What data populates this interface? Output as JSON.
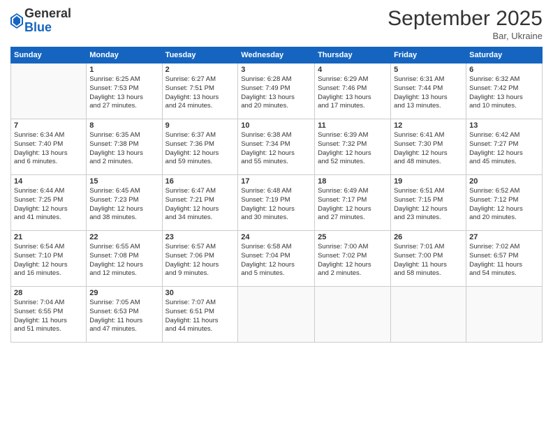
{
  "logo": {
    "general": "General",
    "blue": "Blue"
  },
  "title": "September 2025",
  "location": "Bar, Ukraine",
  "weekdays": [
    "Sunday",
    "Monday",
    "Tuesday",
    "Wednesday",
    "Thursday",
    "Friday",
    "Saturday"
  ],
  "weeks": [
    [
      {
        "day": "",
        "info": ""
      },
      {
        "day": "1",
        "info": "Sunrise: 6:25 AM\nSunset: 7:53 PM\nDaylight: 13 hours\nand 27 minutes."
      },
      {
        "day": "2",
        "info": "Sunrise: 6:27 AM\nSunset: 7:51 PM\nDaylight: 13 hours\nand 24 minutes."
      },
      {
        "day": "3",
        "info": "Sunrise: 6:28 AM\nSunset: 7:49 PM\nDaylight: 13 hours\nand 20 minutes."
      },
      {
        "day": "4",
        "info": "Sunrise: 6:29 AM\nSunset: 7:46 PM\nDaylight: 13 hours\nand 17 minutes."
      },
      {
        "day": "5",
        "info": "Sunrise: 6:31 AM\nSunset: 7:44 PM\nDaylight: 13 hours\nand 13 minutes."
      },
      {
        "day": "6",
        "info": "Sunrise: 6:32 AM\nSunset: 7:42 PM\nDaylight: 13 hours\nand 10 minutes."
      }
    ],
    [
      {
        "day": "7",
        "info": "Sunrise: 6:34 AM\nSunset: 7:40 PM\nDaylight: 13 hours\nand 6 minutes."
      },
      {
        "day": "8",
        "info": "Sunrise: 6:35 AM\nSunset: 7:38 PM\nDaylight: 13 hours\nand 2 minutes."
      },
      {
        "day": "9",
        "info": "Sunrise: 6:37 AM\nSunset: 7:36 PM\nDaylight: 12 hours\nand 59 minutes."
      },
      {
        "day": "10",
        "info": "Sunrise: 6:38 AM\nSunset: 7:34 PM\nDaylight: 12 hours\nand 55 minutes."
      },
      {
        "day": "11",
        "info": "Sunrise: 6:39 AM\nSunset: 7:32 PM\nDaylight: 12 hours\nand 52 minutes."
      },
      {
        "day": "12",
        "info": "Sunrise: 6:41 AM\nSunset: 7:30 PM\nDaylight: 12 hours\nand 48 minutes."
      },
      {
        "day": "13",
        "info": "Sunrise: 6:42 AM\nSunset: 7:27 PM\nDaylight: 12 hours\nand 45 minutes."
      }
    ],
    [
      {
        "day": "14",
        "info": "Sunrise: 6:44 AM\nSunset: 7:25 PM\nDaylight: 12 hours\nand 41 minutes."
      },
      {
        "day": "15",
        "info": "Sunrise: 6:45 AM\nSunset: 7:23 PM\nDaylight: 12 hours\nand 38 minutes."
      },
      {
        "day": "16",
        "info": "Sunrise: 6:47 AM\nSunset: 7:21 PM\nDaylight: 12 hours\nand 34 minutes."
      },
      {
        "day": "17",
        "info": "Sunrise: 6:48 AM\nSunset: 7:19 PM\nDaylight: 12 hours\nand 30 minutes."
      },
      {
        "day": "18",
        "info": "Sunrise: 6:49 AM\nSunset: 7:17 PM\nDaylight: 12 hours\nand 27 minutes."
      },
      {
        "day": "19",
        "info": "Sunrise: 6:51 AM\nSunset: 7:15 PM\nDaylight: 12 hours\nand 23 minutes."
      },
      {
        "day": "20",
        "info": "Sunrise: 6:52 AM\nSunset: 7:12 PM\nDaylight: 12 hours\nand 20 minutes."
      }
    ],
    [
      {
        "day": "21",
        "info": "Sunrise: 6:54 AM\nSunset: 7:10 PM\nDaylight: 12 hours\nand 16 minutes."
      },
      {
        "day": "22",
        "info": "Sunrise: 6:55 AM\nSunset: 7:08 PM\nDaylight: 12 hours\nand 12 minutes."
      },
      {
        "day": "23",
        "info": "Sunrise: 6:57 AM\nSunset: 7:06 PM\nDaylight: 12 hours\nand 9 minutes."
      },
      {
        "day": "24",
        "info": "Sunrise: 6:58 AM\nSunset: 7:04 PM\nDaylight: 12 hours\nand 5 minutes."
      },
      {
        "day": "25",
        "info": "Sunrise: 7:00 AM\nSunset: 7:02 PM\nDaylight: 12 hours\nand 2 minutes."
      },
      {
        "day": "26",
        "info": "Sunrise: 7:01 AM\nSunset: 7:00 PM\nDaylight: 11 hours\nand 58 minutes."
      },
      {
        "day": "27",
        "info": "Sunrise: 7:02 AM\nSunset: 6:57 PM\nDaylight: 11 hours\nand 54 minutes."
      }
    ],
    [
      {
        "day": "28",
        "info": "Sunrise: 7:04 AM\nSunset: 6:55 PM\nDaylight: 11 hours\nand 51 minutes."
      },
      {
        "day": "29",
        "info": "Sunrise: 7:05 AM\nSunset: 6:53 PM\nDaylight: 11 hours\nand 47 minutes."
      },
      {
        "day": "30",
        "info": "Sunrise: 7:07 AM\nSunset: 6:51 PM\nDaylight: 11 hours\nand 44 minutes."
      },
      {
        "day": "",
        "info": ""
      },
      {
        "day": "",
        "info": ""
      },
      {
        "day": "",
        "info": ""
      },
      {
        "day": "",
        "info": ""
      }
    ]
  ]
}
